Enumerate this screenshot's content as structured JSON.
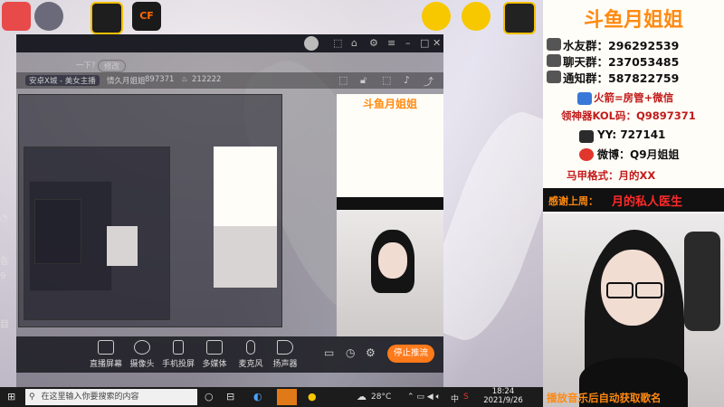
{
  "window": {
    "tags": [
      "修改"
    ],
    "broadcast_title": "一下?",
    "category": "安卓X城 - 美女主播",
    "streamer": "情久月姐姐",
    "room_id": "897371",
    "heat": "212222"
  },
  "right_panel": {
    "title": "斗鱼月姐姐",
    "lines": [
      {
        "label": "水友群：",
        "value": "296292539"
      },
      {
        "label": "聊天群：",
        "value": "237053485"
      },
      {
        "label": "通知群：",
        "value": "587822759"
      }
    ],
    "fire_line": "火箭=房管+微信",
    "kol_line": "领神器KOL码：Q9897371",
    "yy_line": "YY: 727141",
    "weibo_line": "微博：Q9月姐姐",
    "format_line": "马甲格式：月的XX",
    "thanks_label": "感谢上周：",
    "thanks_name": "月的私人医生",
    "bottom_caption": "播放音乐后自动获取歌名"
  },
  "toolbar": {
    "items": [
      {
        "label": "直播屏幕",
        "icon": "monitor-icon"
      },
      {
        "label": "摄像头",
        "icon": "camera-icon"
      },
      {
        "label": "手机投屏",
        "icon": "phone-icon"
      },
      {
        "label": "多媒体",
        "icon": "media-icon"
      },
      {
        "label": "麦克风",
        "icon": "mic-icon"
      },
      {
        "label": "扬声器",
        "icon": "speaker-icon"
      }
    ],
    "stop_label": "停止推流"
  },
  "taskbar": {
    "search_placeholder": "在这里输入你要搜索的内容",
    "temperature": "28°C",
    "time": "18:24",
    "date": "2021/9/26",
    "ime": "中"
  },
  "sidebar": {
    "items": [
      "各",
      "9",
      "目"
    ]
  },
  "colors": {
    "accent": "#ff7a1a",
    "title_orange": "#ff8a10",
    "thanks_red": "#ff2a2a"
  }
}
